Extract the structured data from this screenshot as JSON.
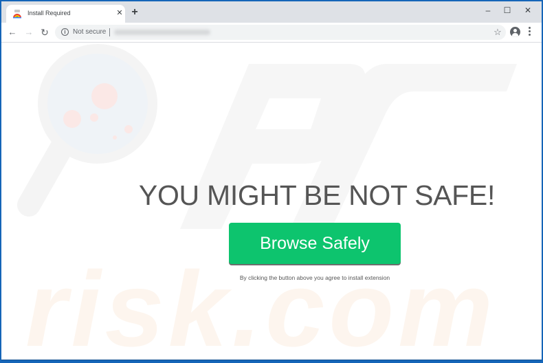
{
  "browser": {
    "tab": {
      "title": "Install Required",
      "favicon": "chrome-web-store-icon",
      "close_glyph": "✕"
    },
    "new_tab_glyph": "+",
    "window_controls": {
      "minimize": "–",
      "maximize": "☐",
      "close": "✕"
    },
    "toolbar": {
      "back_glyph": "←",
      "forward_glyph": "→",
      "reload_glyph": "↻",
      "security_icon": "i",
      "security_label": "Not secure",
      "url": "",
      "bookmark_glyph": "☆"
    }
  },
  "page": {
    "headline": "YOU MIGHT BE NOT SAFE!",
    "cta_label": "Browse Safely",
    "disclaimer": "By clicking the button above you agree to install extension",
    "colors": {
      "cta_background": "#0dc46e",
      "headline": "#555555",
      "window_border": "#1565b8"
    },
    "watermark_text": "risk.com"
  }
}
